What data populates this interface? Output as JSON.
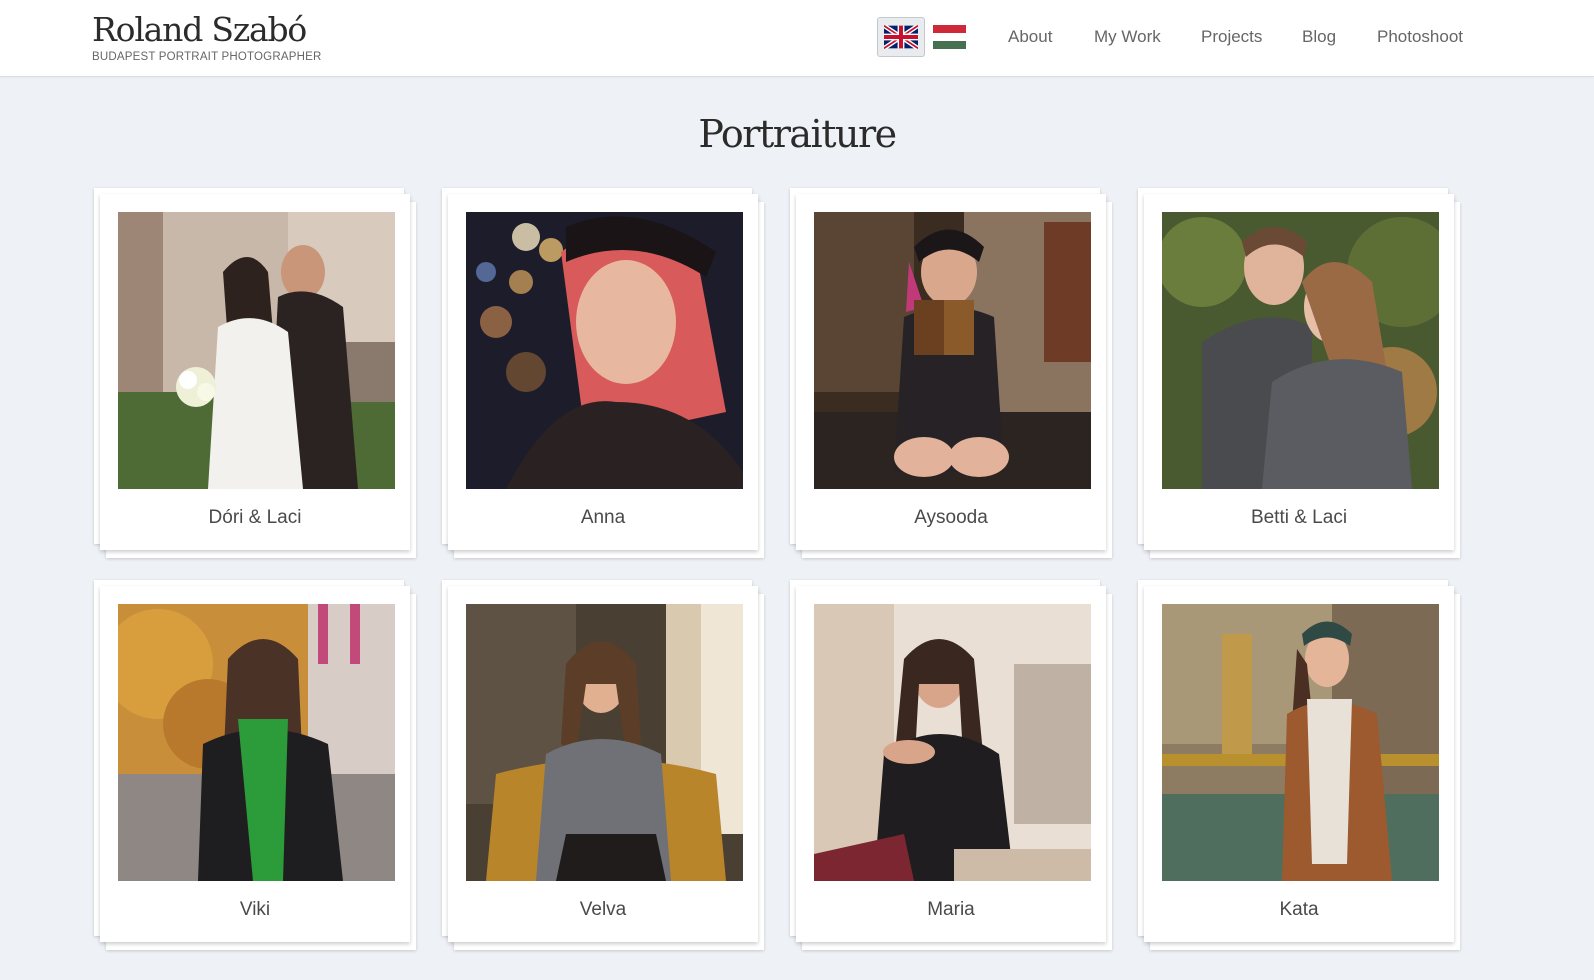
{
  "brand": {
    "name": "Roland Szabó",
    "tagline": "BUDAPEST PORTRAIT PHOTOGRAPHER"
  },
  "languages": [
    {
      "code": "en",
      "icon": "uk-flag-icon",
      "selected": true
    },
    {
      "code": "hu",
      "icon": "hungary-flag-icon",
      "selected": false
    }
  ],
  "nav": {
    "items": [
      "About",
      "My Work",
      "Projects",
      "Blog",
      "Photoshoot"
    ]
  },
  "page": {
    "title": "Portraiture"
  },
  "gallery": [
    {
      "caption": "Dóri & Laci"
    },
    {
      "caption": "Anna"
    },
    {
      "caption": "Aysooda"
    },
    {
      "caption": "Betti & Laci"
    },
    {
      "caption": "Viki"
    },
    {
      "caption": "Velva"
    },
    {
      "caption": "Maria"
    },
    {
      "caption": "Kata"
    }
  ],
  "colors": {
    "background": "#eef2f6",
    "header": "#ffffff",
    "text": "#2b2b2b"
  }
}
